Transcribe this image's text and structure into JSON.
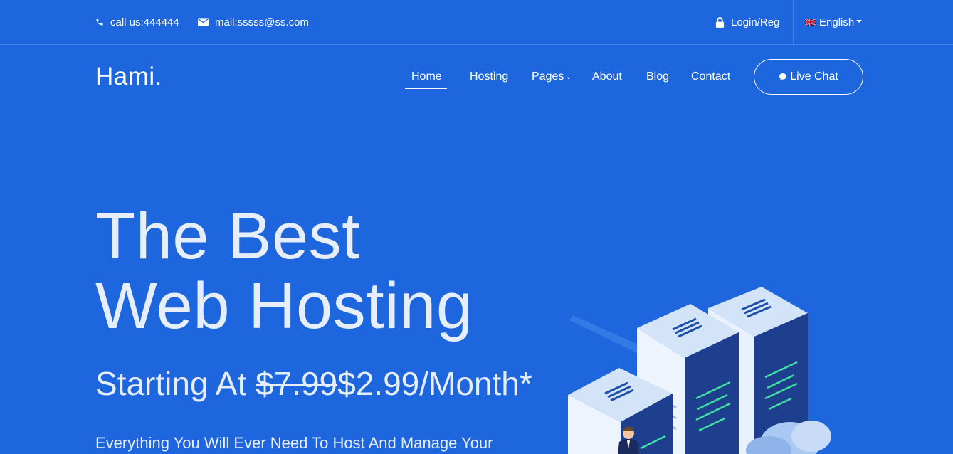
{
  "topbar": {
    "phone": "call us:444444",
    "email": "mail:sssss@ss.com",
    "login": "Login/Reg",
    "language": "English"
  },
  "nav": {
    "logo": "Hami.",
    "items": [
      {
        "label": "Home",
        "active": true
      },
      {
        "label": "Hosting"
      },
      {
        "label": "Pages",
        "has_dropdown": true
      },
      {
        "label": "About"
      },
      {
        "label": "Blog"
      },
      {
        "label": "Contact"
      }
    ],
    "live_chat": "Live Chat"
  },
  "hero": {
    "title_line1": "The Best",
    "title_line2": "Web Hosting",
    "price_prefix": "Starting At ",
    "old_price": "$7.99",
    "new_price": "$2.99/Month*",
    "description": "Everything You Will Ever Need To Host And Manage Your"
  },
  "icons": {
    "phone": "phone-icon",
    "mail": "mail-icon",
    "login": "lock-icon",
    "language": "uk-flag-icon",
    "live_chat": "chat-bubble-icon"
  },
  "colors": {
    "background": "#1e66de",
    "text": "#ffffff",
    "hero_text": "#e6eefc"
  }
}
